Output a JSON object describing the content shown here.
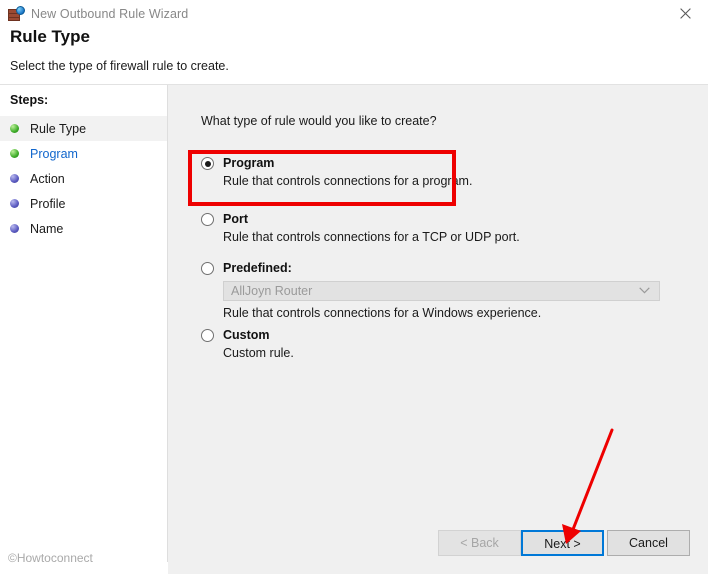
{
  "window": {
    "title": "New Outbound Rule Wizard",
    "icon": "firewall-globe-icon",
    "close_label": "✕"
  },
  "header": {
    "title": "Rule Type",
    "subtitle": "Select the type of firewall rule to create."
  },
  "sidebar": {
    "heading": "Steps:",
    "items": [
      {
        "label": "Rule Type",
        "dot": "green",
        "state": "active"
      },
      {
        "label": "Program",
        "dot": "green",
        "state": "link"
      },
      {
        "label": "Action",
        "dot": "blue",
        "state": "pending"
      },
      {
        "label": "Profile",
        "dot": "blue",
        "state": "pending"
      },
      {
        "label": "Name",
        "dot": "blue",
        "state": "pending"
      }
    ]
  },
  "main": {
    "question": "What type of rule would you like to create?",
    "options": [
      {
        "title": "Program",
        "description": "Rule that controls connections for a program.",
        "selected": true
      },
      {
        "title": "Port",
        "description": "Rule that controls connections for a TCP or UDP port.",
        "selected": false
      },
      {
        "title": "Predefined:",
        "description": "Rule that controls connections for a Windows experience.",
        "selected": false,
        "dropdown_value": "AllJoyn Router",
        "dropdown_enabled": false
      },
      {
        "title": "Custom",
        "description": "Custom rule.",
        "selected": false
      }
    ]
  },
  "buttons": {
    "back": "< Back",
    "next": "Next >",
    "cancel": "Cancel"
  },
  "annotations": {
    "highlight_color": "#ee0000",
    "arrow_color": "#ee0000",
    "arrow_target": "next-button"
  },
  "watermark": "©Howtoconnect"
}
